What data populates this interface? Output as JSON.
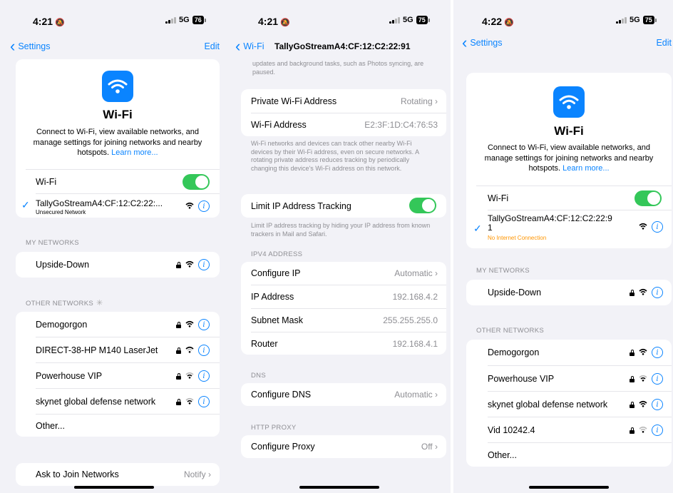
{
  "colors": {
    "accent": "#0a84ff",
    "toggle_on": "#34c759",
    "warning": "#ff9500",
    "bg": "#f2f2f7"
  },
  "icons": [
    "wifi-icon",
    "lock-icon",
    "info-icon",
    "chevron-left-icon",
    "chevron-right-icon",
    "checkmark-icon",
    "bell-slash-icon",
    "signal-icon",
    "battery-icon",
    "loading-spinner-icon"
  ],
  "p1": {
    "status": {
      "time": "4:21",
      "network": "5G",
      "battery": "76"
    },
    "nav": {
      "back": "Settings",
      "edit": "Edit"
    },
    "hero": {
      "title": "Wi-Fi",
      "desc": "Connect to Wi-Fi, view available networks, and manage settings for joining networks and nearby hotspots.",
      "link": "Learn more..."
    },
    "wifi_label": "Wi-Fi",
    "connected": {
      "name": "TallyGoStreamA4:CF:12:C2:22:...",
      "sub": "Unsecured Network"
    },
    "my_header": "MY NETWORKS",
    "my_networks": [
      "Upside-Down"
    ],
    "other_header": "OTHER NETWORKS",
    "other_networks": [
      "Demogorgon",
      "DIRECT-38-HP M140 LaserJet",
      "Powerhouse VIP",
      "skynet global defense network"
    ],
    "other_label": "Other...",
    "ask": {
      "label": "Ask to Join Networks",
      "value": "Notify"
    }
  },
  "p2": {
    "status": {
      "time": "4:21",
      "network": "5G",
      "battery": "75"
    },
    "nav": {
      "back": "Wi-Fi",
      "title": "TallyGoStreamA4:CF:12:C2:22:91"
    },
    "top_text": "updates and background tasks, such as Photos syncing, are paused.",
    "private": {
      "label": "Private Wi-Fi Address",
      "value": "Rotating"
    },
    "address": {
      "label": "Wi-Fi Address",
      "value": "E2:3F:1D:C4:76:53"
    },
    "address_note": "Wi-Fi networks and devices can track other nearby Wi-Fi devices by their Wi-Fi address, even on secure networks. A rotating private address reduces tracking by periodically changing this device's Wi-Fi address on this network.",
    "limit": {
      "label": "Limit IP Address Tracking"
    },
    "limit_note": "Limit IP address tracking by hiding your IP address from known trackers in Mail and Safari.",
    "ipv4_header": "IPV4 ADDRESS",
    "ipv4": [
      {
        "label": "Configure IP",
        "value": "Automatic",
        "chevron": true
      },
      {
        "label": "IP Address",
        "value": "192.168.4.2",
        "chevron": false
      },
      {
        "label": "Subnet Mask",
        "value": "255.255.255.0",
        "chevron": false
      },
      {
        "label": "Router",
        "value": "192.168.4.1",
        "chevron": false
      }
    ],
    "dns_header": "DNS",
    "dns": {
      "label": "Configure DNS",
      "value": "Automatic"
    },
    "proxy_header": "HTTP PROXY",
    "proxy": {
      "label": "Configure Proxy",
      "value": "Off"
    }
  },
  "p3": {
    "status": {
      "time": "4:22",
      "network": "5G",
      "battery": "75"
    },
    "nav": {
      "back": "Settings",
      "edit": "Edit"
    },
    "hero": {
      "title": "Wi-Fi",
      "desc": "Connect to Wi-Fi, view available networks, and manage settings for joining networks and nearby hotspots.",
      "link": "Learn more..."
    },
    "wifi_label": "Wi-Fi",
    "connected": {
      "name": "TallyGoStreamA4:CF:12:C2:22:9",
      "name2": "1",
      "sub": "No Internet Connection"
    },
    "my_header": "MY NETWORKS",
    "my_networks": [
      "Upside-Down"
    ],
    "other_header": "OTHER NETWORKS",
    "other_networks": [
      "Demogorgon",
      "Powerhouse VIP",
      "skynet global defense network",
      "Vid 10242.4"
    ],
    "other_label": "Other..."
  }
}
